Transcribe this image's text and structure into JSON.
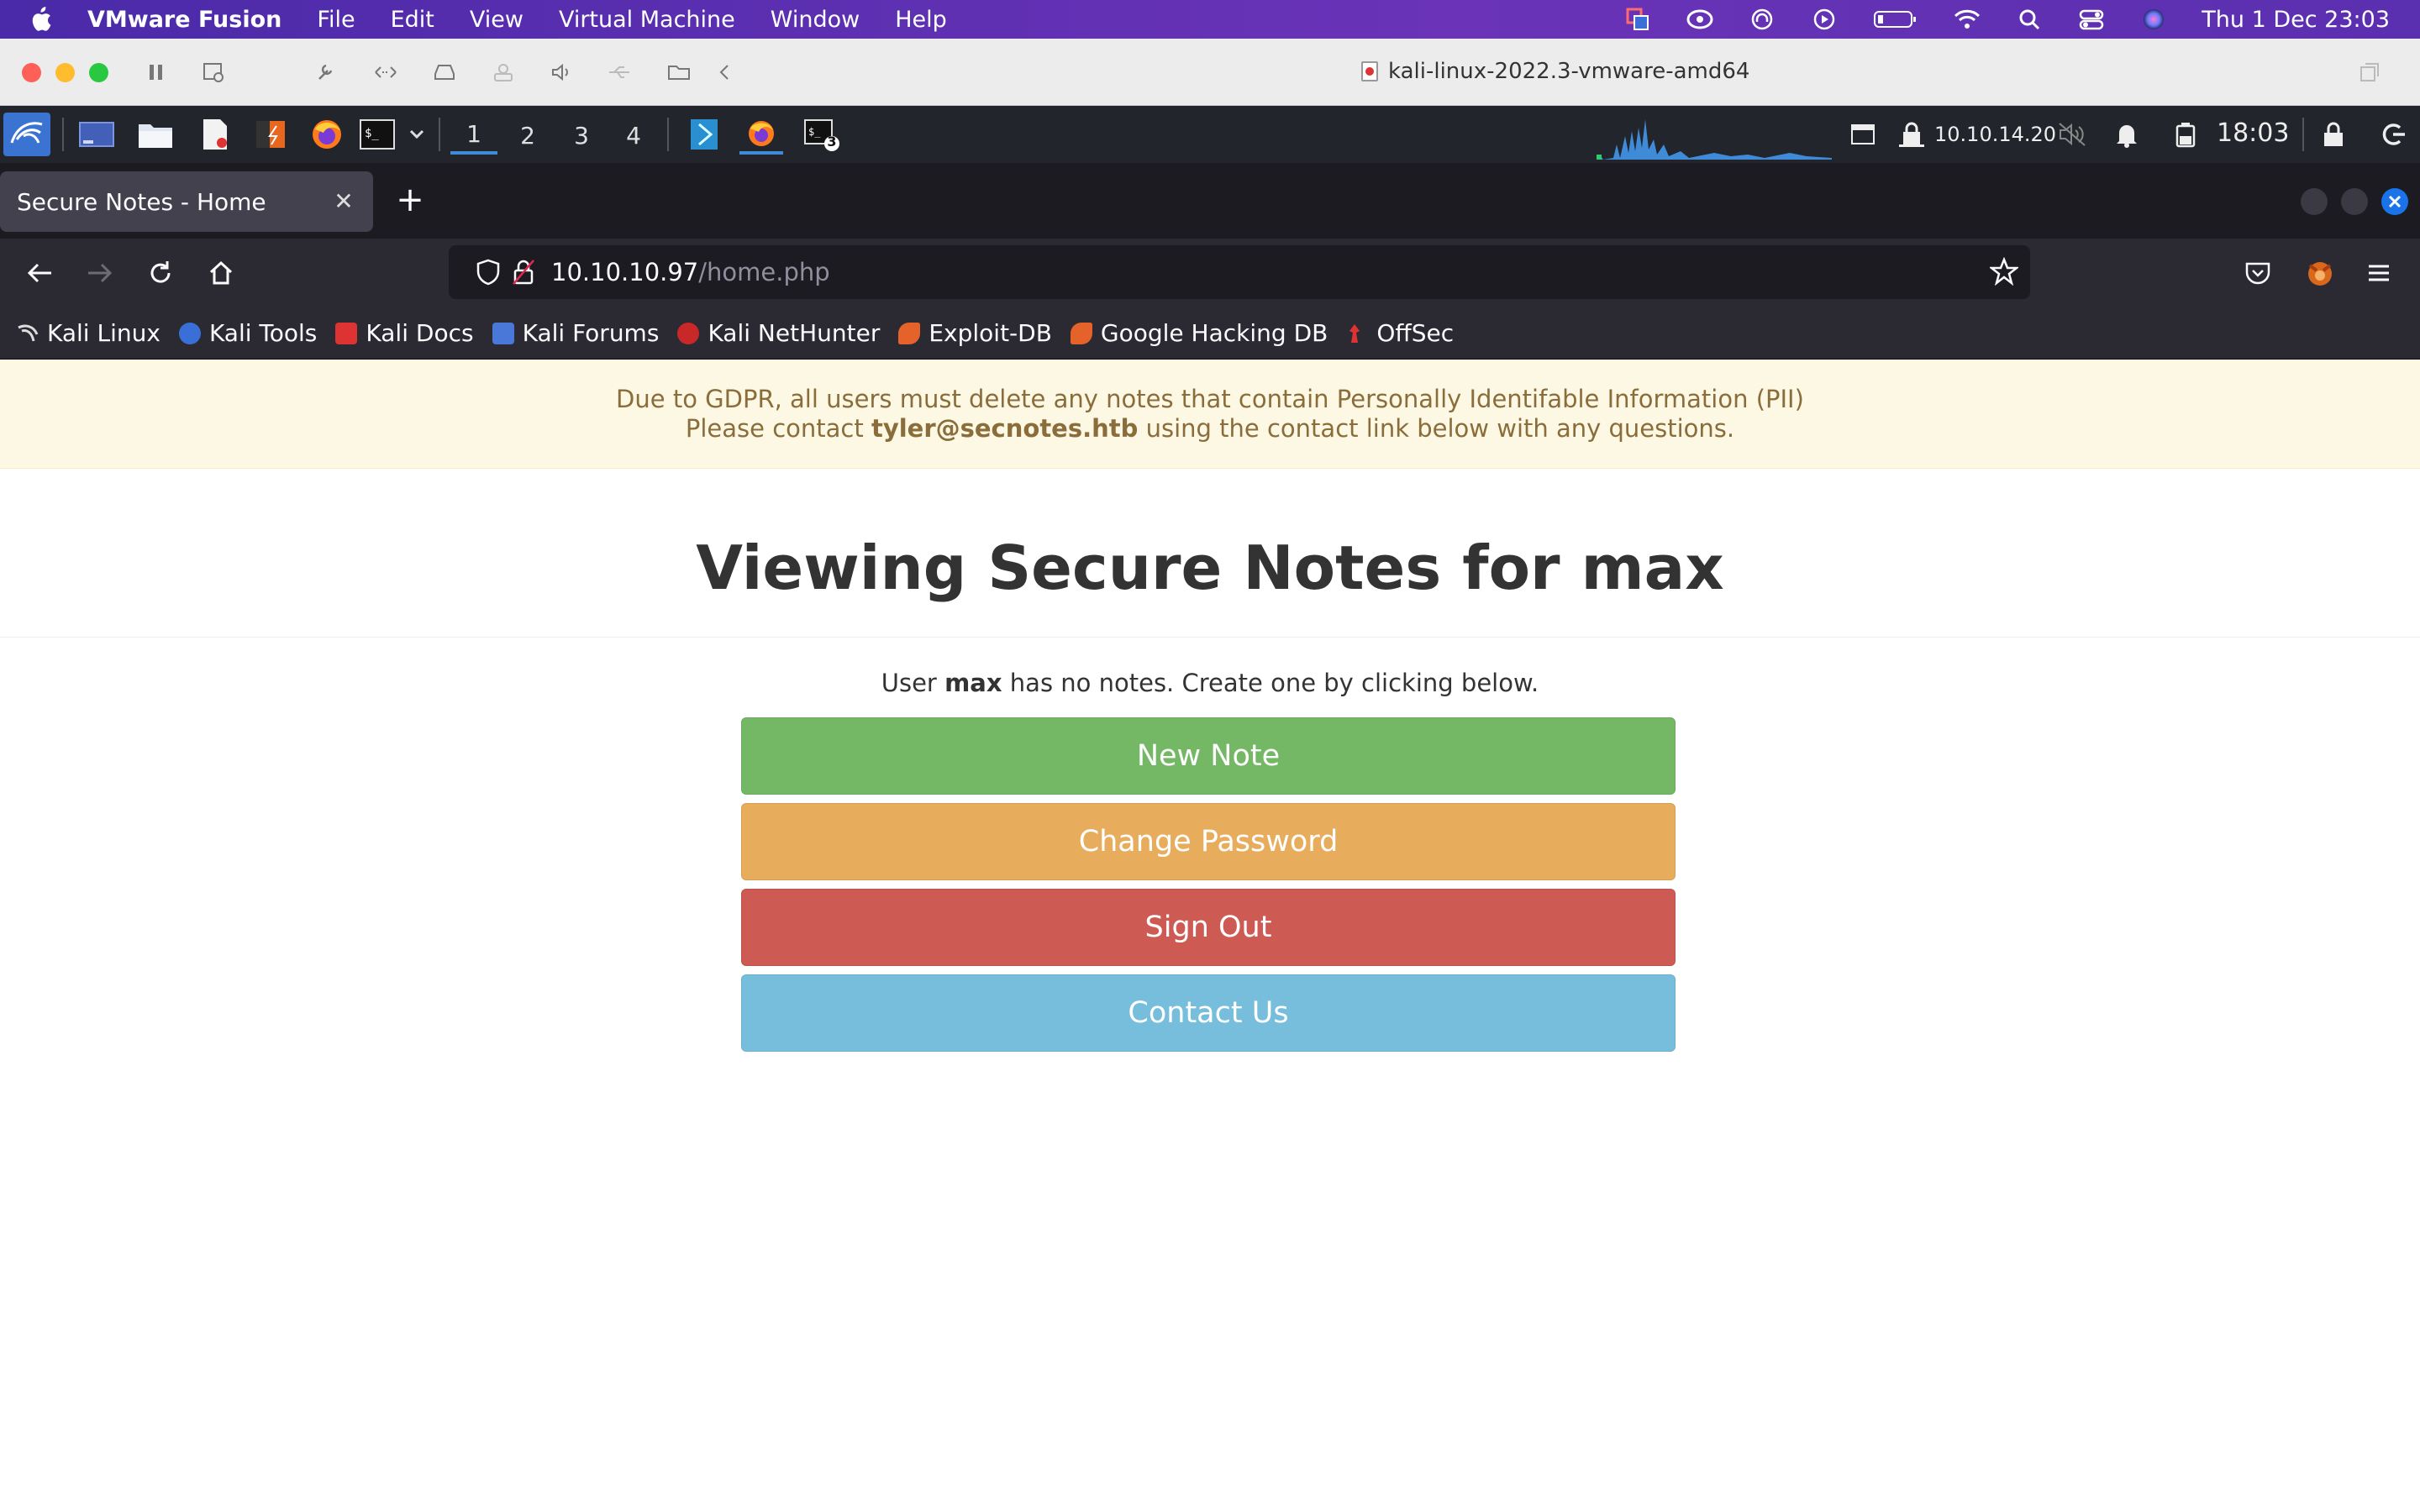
{
  "mac_menubar": {
    "app": "VMware Fusion",
    "menus": [
      "File",
      "Edit",
      "View",
      "Virtual Machine",
      "Window",
      "Help"
    ],
    "clock": "Thu 1 Dec  23:03"
  },
  "vm_window": {
    "title": "kali-linux-2022.3-vmware-amd64"
  },
  "kali_panel": {
    "workspaces": [
      "1",
      "2",
      "3",
      "4"
    ],
    "active_workspace": "1",
    "terminal_badge": "3",
    "ip": "10.10.14.20",
    "time": "18:03"
  },
  "browser": {
    "tab_title": "Secure Notes - Home",
    "url_host": "10.10.10.97",
    "url_path": "/home.php",
    "bookmarks": [
      "Kali Linux",
      "Kali Tools",
      "Kali Docs",
      "Kali Forums",
      "Kali NetHunter",
      "Exploit-DB",
      "Google Hacking DB",
      "OffSec"
    ]
  },
  "page": {
    "gdpr_line1": "Due to GDPR, all users must delete any notes that contain Personally Identifable Information (PII)",
    "gdpr_line2_pre": "Please contact ",
    "gdpr_email": "tyler@secnotes.htb",
    "gdpr_line2_post": " using the contact link below with any questions.",
    "title_pre": "Viewing Secure Notes for ",
    "title_user": "max",
    "notes_pre": "User ",
    "notes_user": "max",
    "notes_post": " has no notes. Create one by clicking below.",
    "buttons": {
      "new_note": "New Note",
      "change_password": "Change Password",
      "sign_out": "Sign Out",
      "contact_us": "Contact Us"
    },
    "button_colors": {
      "new_note": "#74b866",
      "change_password": "#e7ad5d",
      "sign_out": "#ce5a54",
      "contact_us": "#76bedc"
    }
  }
}
